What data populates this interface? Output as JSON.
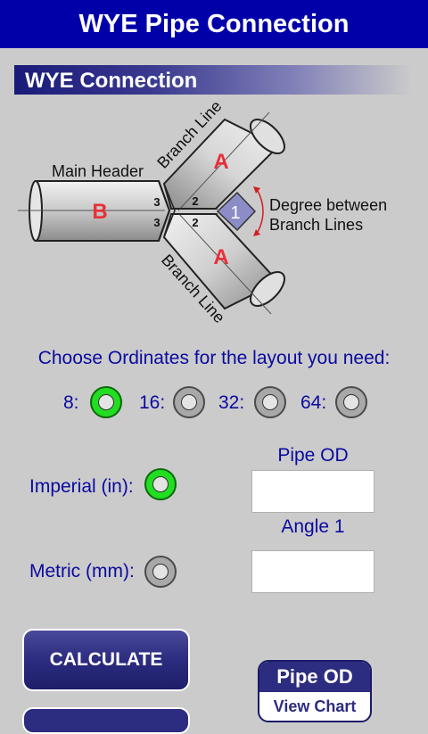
{
  "app": {
    "title": "WYE Pipe Connection"
  },
  "section": {
    "title": "WYE Connection"
  },
  "diagram": {
    "main_header_label": "Main Header",
    "branch_line_label": "Branch Line",
    "pipe_a_label": "A",
    "pipe_b_label": "B",
    "marker_3": "3",
    "marker_2": "2",
    "angle_marker": "1",
    "degree_line1": "Degree between",
    "degree_line2": "Branch Lines"
  },
  "ordinates": {
    "prompt": "Choose Ordinates for the layout you need:",
    "options": [
      {
        "label": "8:",
        "selected": true
      },
      {
        "label": "16:",
        "selected": false
      },
      {
        "label": "32:",
        "selected": false
      },
      {
        "label": "64:",
        "selected": false
      }
    ]
  },
  "units": {
    "imperial_label": "Imperial (in):",
    "imperial_selected": true,
    "metric_label": "Metric (mm):",
    "metric_selected": false
  },
  "inputs": {
    "pipe_od_label": "Pipe OD",
    "pipe_od_value": "",
    "angle_label": "Angle 1",
    "angle_value": ""
  },
  "buttons": {
    "calculate": "CALCULATE",
    "chart_title": "Pipe OD",
    "chart_sub": "View Chart"
  },
  "colors": {
    "title_bar": "#0000a8",
    "label_text": "#0a0aa0",
    "radio_selected": "#22dd22",
    "pipe_letter": "#e8303a",
    "button": "#2c2c80"
  }
}
